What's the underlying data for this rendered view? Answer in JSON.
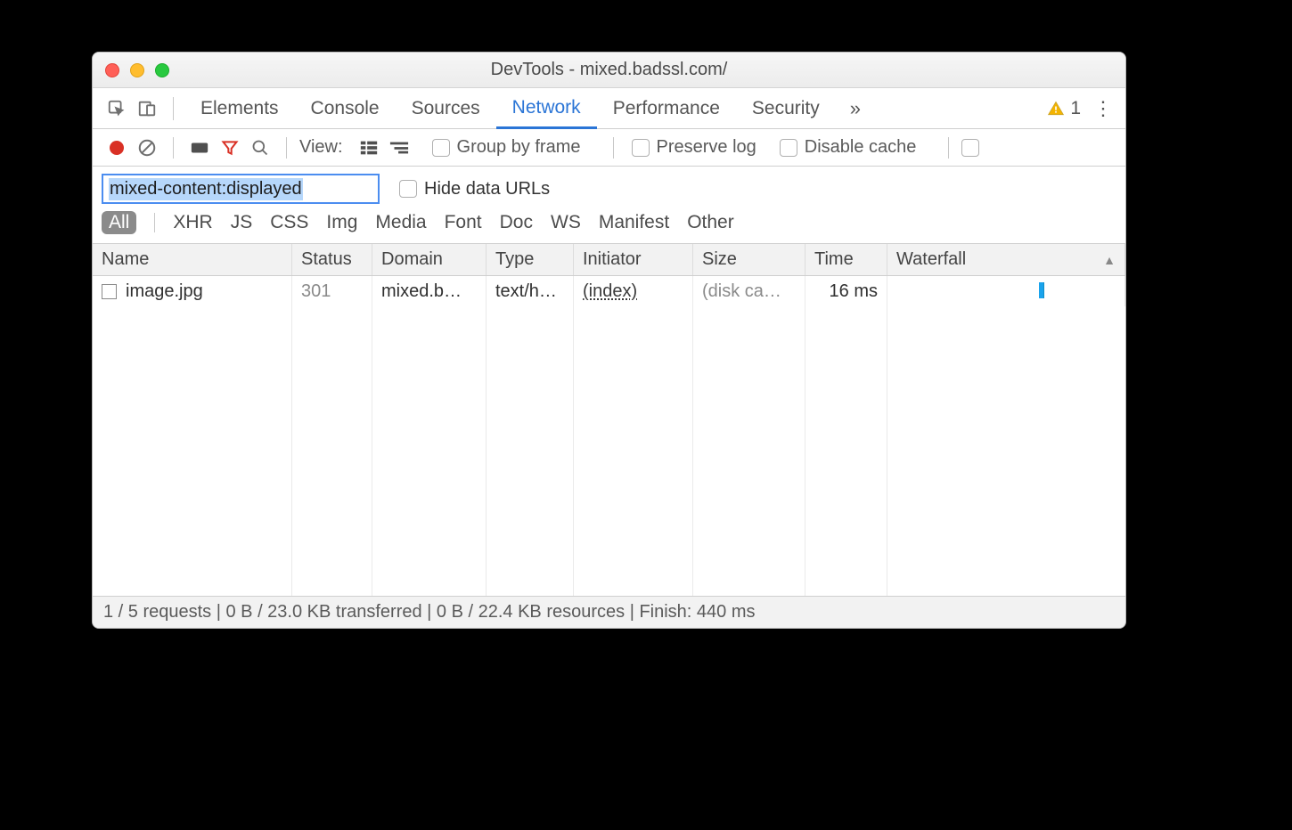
{
  "window": {
    "title": "DevTools - mixed.badssl.com/"
  },
  "tabs": {
    "items": [
      "Elements",
      "Console",
      "Sources",
      "Network",
      "Performance",
      "Security"
    ],
    "active": "Network",
    "warning_count": "1"
  },
  "toolbar": {
    "view_label": "View:",
    "group_by_frame": "Group by frame",
    "preserve_log": "Preserve log",
    "disable_cache": "Disable cache"
  },
  "filter": {
    "value": "mixed-content:displayed",
    "hide_data_urls": "Hide data URLs"
  },
  "types": {
    "all": "All",
    "items": [
      "XHR",
      "JS",
      "CSS",
      "Img",
      "Media",
      "Font",
      "Doc",
      "WS",
      "Manifest",
      "Other"
    ]
  },
  "columns": {
    "name": "Name",
    "status": "Status",
    "domain": "Domain",
    "type": "Type",
    "initiator": "Initiator",
    "size": "Size",
    "time": "Time",
    "waterfall": "Waterfall"
  },
  "rows": [
    {
      "name": "image.jpg",
      "status": "301",
      "domain": "mixed.b…",
      "type": "text/h…",
      "initiator": "(index)",
      "size": "(disk ca…",
      "time": "16 ms"
    }
  ],
  "statusbar": "1 / 5 requests | 0 B / 23.0 KB transferred | 0 B / 22.4 KB resources | Finish: 440 ms"
}
